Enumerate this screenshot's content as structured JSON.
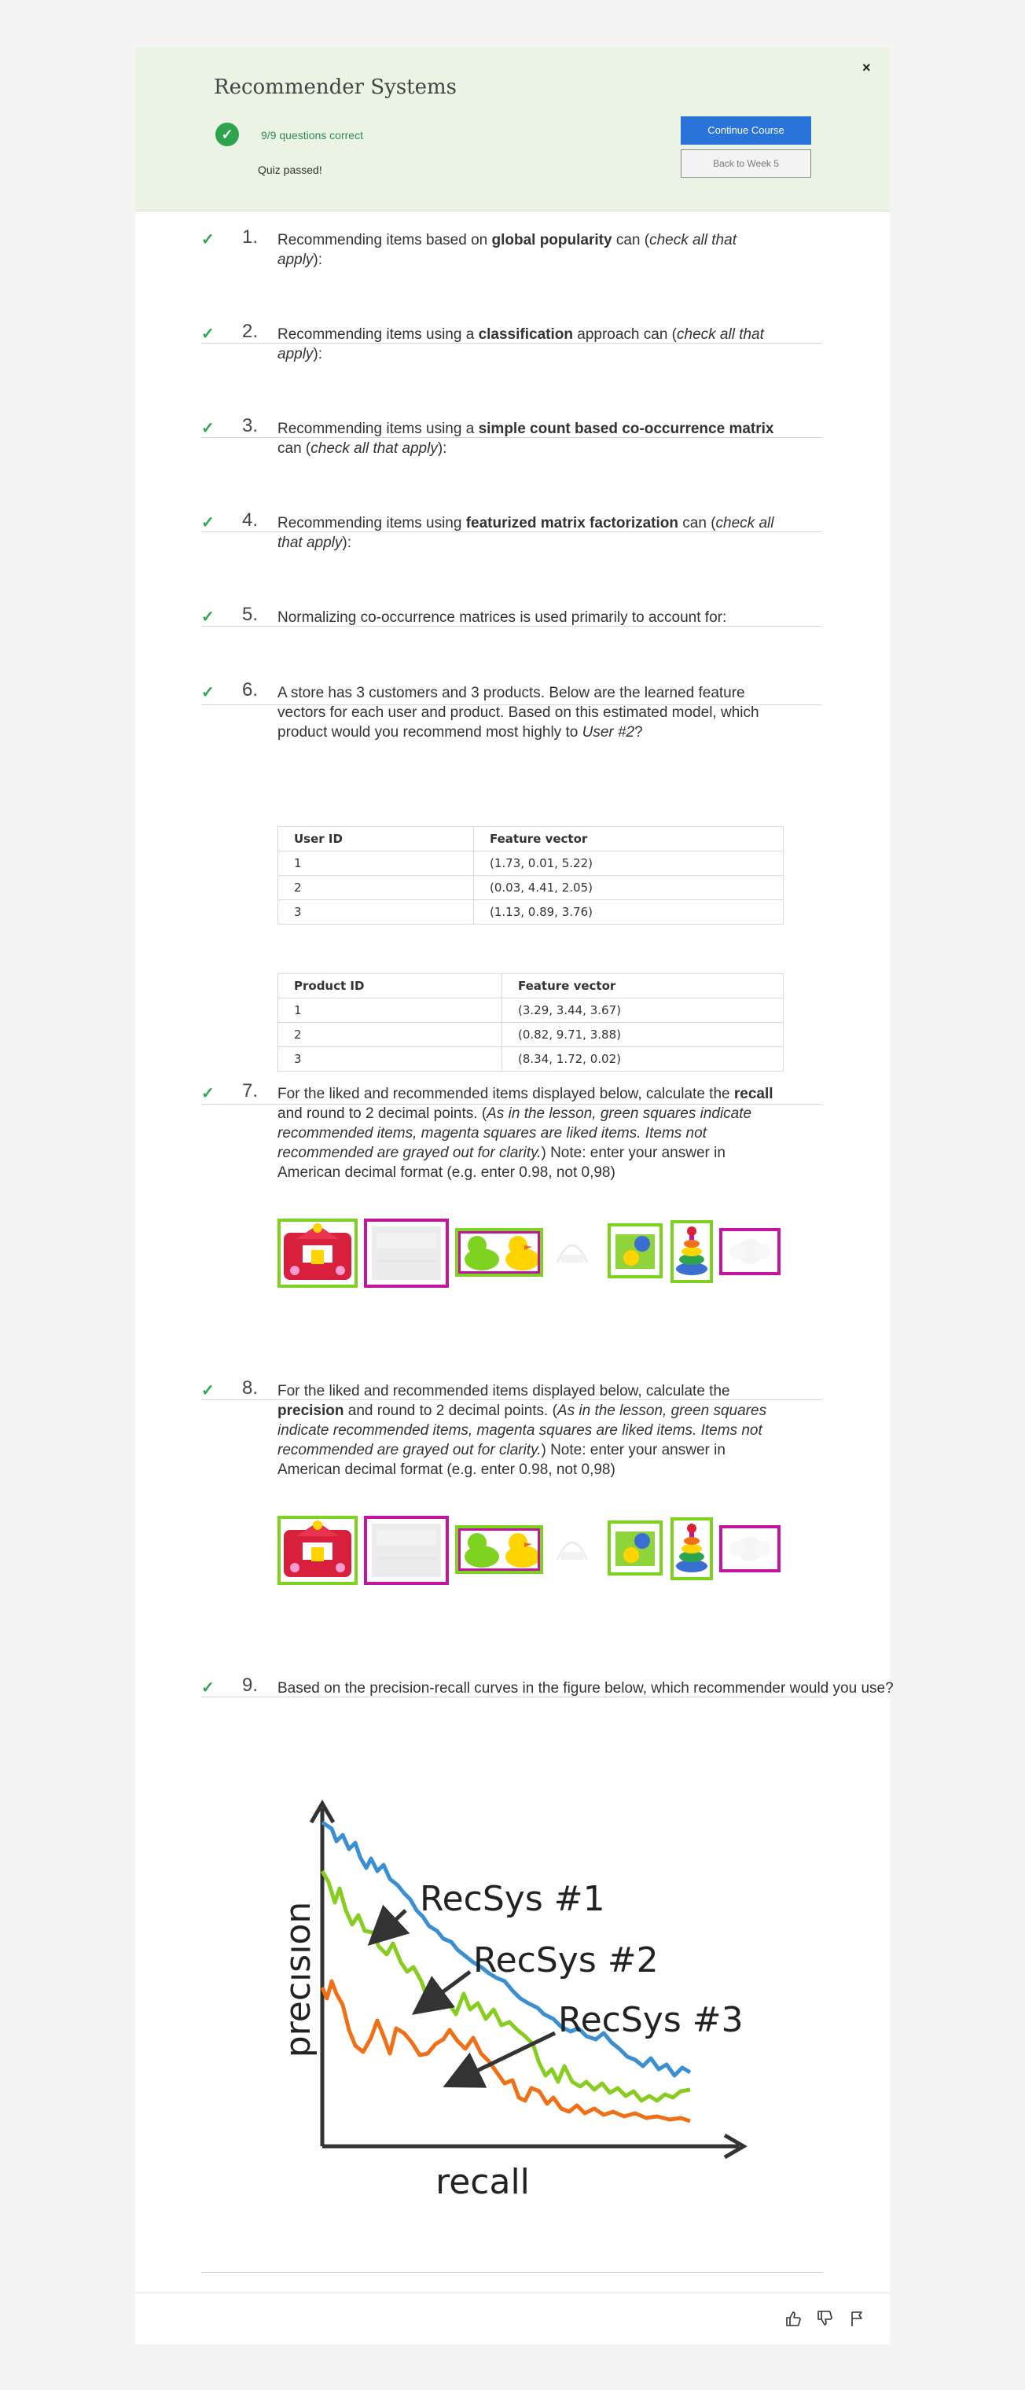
{
  "header": {
    "title": "Recommender Systems",
    "score_text": "9/9 questions correct",
    "passed_text": "Quiz passed!",
    "continue_label": "Continue Course",
    "back_label": "Back to Week 5",
    "close_label": "×"
  },
  "questions": [
    {
      "num": "1.",
      "html": "Recommending items based on <b>global popularity</b> can (<i>check all that apply</i>):"
    },
    {
      "num": "2.",
      "html": "Recommending items using a <b>classification</b> approach can (<i>check all that apply</i>):"
    },
    {
      "num": "3.",
      "html": "Recommending items using a <b>simple count based co-occurrence matrix</b> can (<i>check all that apply</i>):"
    },
    {
      "num": "4.",
      "html": "Recommending items using <b>featurized matrix factorization</b> can (<i>check all that apply</i>):"
    },
    {
      "num": "5.",
      "html": "Normalizing co-occurrence matrices is used primarily to account for:"
    },
    {
      "num": "6.",
      "html": "A store has 3 customers and 3 products. Below are the learned feature vectors for each user and product. Based on this estimated model, which product would you recommend most highly to <i>User #2</i>?"
    },
    {
      "num": "7.",
      "html": "For the liked and recommended items displayed below, calculate the <b>recall</b> and round to 2 decimal points. (<i>As in the lesson, green squares indicate recommended items, magenta squares are liked items. Items not recommended are grayed out for clarity.</i>) Note: enter your answer in American decimal format (e.g. enter 0.98, not 0,98)"
    },
    {
      "num": "8.",
      "html": "For the liked and recommended items displayed below, calculate the <b>precision</b> and round to 2 decimal points. (<i>As in the lesson, green squares indicate recommended items, magenta squares are liked items. Items not recommended are grayed out for clarity.</i>) Note: enter your answer in American decimal format (e.g. enter 0.98, not 0,98)"
    },
    {
      "num": "9.",
      "html": "Based on the precision-recall curves in the figure below, which recommender would you use?"
    }
  ],
  "user_table": {
    "headers": [
      "User ID",
      "Feature vector"
    ],
    "rows": [
      [
        "1",
        "(1.73, 0.01, 5.22)"
      ],
      [
        "2",
        "(0.03, 4.41, 2.05)"
      ],
      [
        "3",
        "(1.13, 0.89, 3.76)"
      ]
    ]
  },
  "product_table": {
    "headers": [
      "Product ID",
      "Feature vector"
    ],
    "rows": [
      [
        "1",
        "(3.29, 3.44, 3.67)"
      ],
      [
        "2",
        "(0.82, 9.71, 3.88)"
      ],
      [
        "3",
        "(8.34, 1.72, 0.02)"
      ]
    ]
  },
  "items_strip": [
    {
      "name": "toy-house",
      "recommended": true,
      "liked": false,
      "grayed": false
    },
    {
      "name": "crib-bedding",
      "recommended": false,
      "liked": true,
      "grayed": true
    },
    {
      "name": "rubber-ducks",
      "recommended": true,
      "liked": true,
      "grayed": false
    },
    {
      "name": "baby-gym",
      "recommended": false,
      "liked": false,
      "grayed": true
    },
    {
      "name": "activity-blocks",
      "recommended": true,
      "liked": false,
      "grayed": false
    },
    {
      "name": "stacking-rings",
      "recommended": true,
      "liked": false,
      "grayed": false
    },
    {
      "name": "flower-pad",
      "recommended": false,
      "liked": true,
      "grayed": true
    }
  ],
  "pr_figure": {
    "xlabel": "recall",
    "ylabel": "precision",
    "labels": [
      "RecSys #1",
      "RecSys #2",
      "RecSys #3"
    ],
    "colors": {
      "recsys1": "#3a8fd1",
      "recsys2": "#88cc22",
      "recsys3": "#f07018"
    }
  },
  "colors": {
    "green_check": "#2ea44f",
    "recommended": "#7ed321",
    "liked": "#c0169e",
    "accent": "#2a73d9"
  },
  "footer_icons": [
    "thumbs-up-icon",
    "thumbs-down-icon",
    "flag-icon"
  ]
}
